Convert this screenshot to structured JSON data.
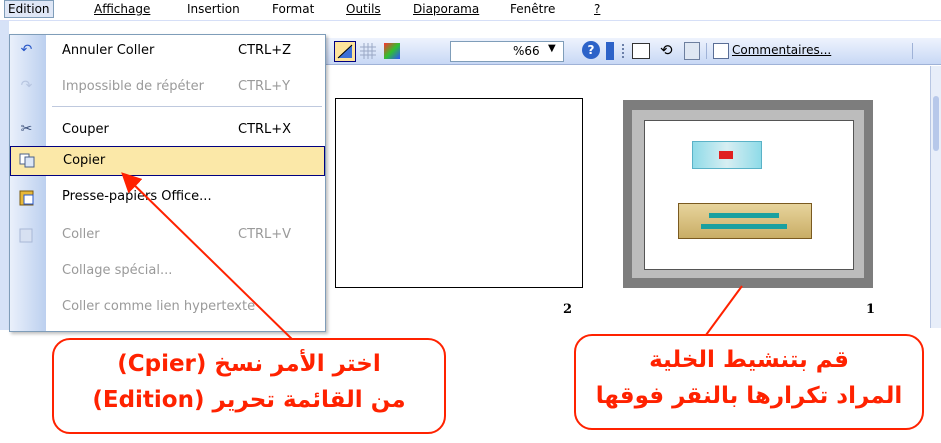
{
  "menubar": {
    "items": [
      {
        "label": "Edition",
        "state": "open"
      },
      {
        "label": "Affichage"
      },
      {
        "label": "Insertion"
      },
      {
        "label": "Format"
      },
      {
        "label": "Outils"
      },
      {
        "label": "Diaporama"
      },
      {
        "label": "Fenêtre"
      },
      {
        "label": "?"
      }
    ]
  },
  "toolbar": {
    "zoom": "%66",
    "comments_label": "Commentaires...",
    "icons": [
      "transparency-icon",
      "grid-icon",
      "color-icon",
      "zoom-dropdown-icon",
      "help-icon",
      "toolbar-options-icon",
      "slide-icon",
      "rotate-icon",
      "copy-slide-icon",
      "comments-icon"
    ]
  },
  "edit_menu": {
    "items": [
      {
        "label": "Annuler Coller",
        "shortcut": "CTRL+Z",
        "icon": "undo-icon",
        "enabled": true
      },
      {
        "label": "Impossible de répéter",
        "shortcut": "CTRL+Y",
        "icon": "redo-icon",
        "enabled": false
      },
      {
        "label": "Couper",
        "shortcut": "CTRL+X",
        "icon": "scissors-icon",
        "enabled": true
      },
      {
        "label": "Copier",
        "shortcut": "",
        "icon": "copy-icon",
        "enabled": true,
        "highlighted": true
      },
      {
        "label": "Presse-papiers Office...",
        "shortcut": "",
        "icon": "clipboard-icon",
        "enabled": true
      },
      {
        "label": "Coller",
        "shortcut": "CTRL+V",
        "icon": "paste-icon",
        "enabled": false
      },
      {
        "label": "Collage spécial...",
        "shortcut": "",
        "icon": "",
        "enabled": false
      },
      {
        "label": "Coller comme lien hypertexte",
        "shortcut": "",
        "icon": "",
        "enabled": false
      }
    ]
  },
  "slides": {
    "slide2_number": "2",
    "slide1_number": "1"
  },
  "callouts": {
    "left": {
      "line1": "اختر الأمر نسخ (Cpier)",
      "line2": "من القائمة تحرير (Edition)"
    },
    "right": {
      "line1": "قم بتنشيط الخلية",
      "line2": "المراد تكرارها بالنقر فوقها"
    }
  },
  "colors": {
    "accent": "#ff2200",
    "menu_highlight": "#fbe8a8",
    "toolbar": "#c8d8f5"
  }
}
